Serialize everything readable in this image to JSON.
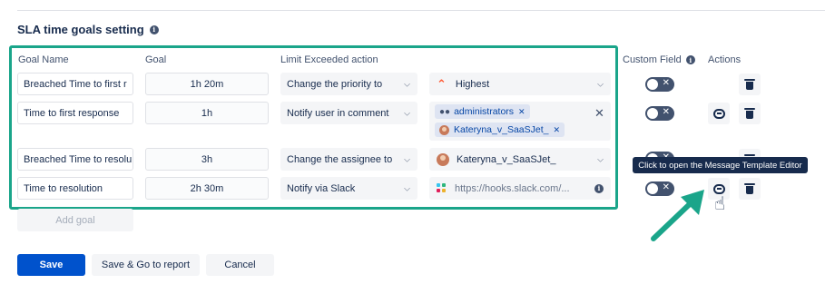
{
  "section": {
    "title": "SLA time goals setting",
    "info_icon": "info-icon"
  },
  "columns": {
    "goal_name": "Goal Name",
    "goal": "Goal",
    "limit_action": "Limit Exceeded action",
    "custom_field": "Custom Field",
    "actions": "Actions"
  },
  "rows": [
    {
      "name": "Breached Time to first r",
      "goal": "1h 20m",
      "action": "Change the priority to",
      "target": "Highest"
    },
    {
      "name": "Time to first response",
      "goal": "1h",
      "action": "Notify user in comment",
      "tags": [
        "administrators",
        "Kateryna_v_SaaSJet_"
      ]
    },
    {
      "name": "Breached Time to resolu",
      "goal": "3h",
      "action": "Change the assignee to",
      "target": "Kateryna_v_SaaSJet_"
    },
    {
      "name": "Time to resolution",
      "goal": "2h 30m",
      "action": "Notify via Slack",
      "target": "https://hooks.slack.com/..."
    }
  ],
  "tooltip": "Click to open the Message Template Editor",
  "add_goal": "Add goal",
  "buttons": {
    "save": "Save",
    "save_report": "Save & Go to report",
    "cancel": "Cancel"
  },
  "colors": {
    "accent": "#0052cc",
    "highlight": "#1aa58a",
    "priority": "#ff5630"
  }
}
